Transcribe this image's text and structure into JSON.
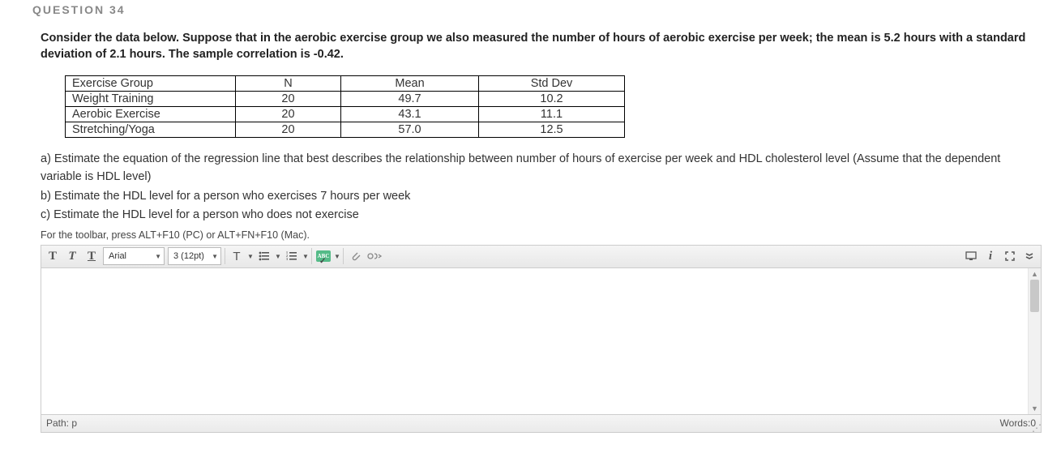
{
  "question_label": "QUESTION 34",
  "prompt": "Consider the data below. Suppose that in the aerobic exercise group we also measured the number of hours of aerobic exercise per week; the mean is 5.2 hours with a standard deviation of 2.1 hours. The sample correlation is -0.42.",
  "table": {
    "headers": [
      "Exercise Group",
      "N",
      "Mean",
      "Std Dev"
    ],
    "rows": [
      [
        "Weight Training",
        "20",
        "49.7",
        "10.2"
      ],
      [
        "Aerobic Exercise",
        "20",
        "43.1",
        "11.1"
      ],
      [
        "Stretching/Yoga",
        "20",
        "57.0",
        "12.5"
      ]
    ]
  },
  "parts": {
    "a": "a) Estimate the equation of the regression line that best describes the relationship between number of hours of exercise per week and HDL cholesterol level (Assume that the dependent variable is HDL level)",
    "b": "b) Estimate the HDL level for a person who exercises 7 hours per week",
    "c": "c) Estimate the HDL level for a person who does not exercise"
  },
  "toolbar_hint": "For the toolbar, press ALT+F10 (PC) or ALT+FN+F10 (Mac).",
  "toolbar": {
    "bold": "T",
    "italic": "T",
    "underline": "T",
    "font_family": "Arial",
    "font_size": "3 (12pt)",
    "text_color": "T"
  },
  "status": {
    "path": "Path: p",
    "words": "Words:0"
  }
}
